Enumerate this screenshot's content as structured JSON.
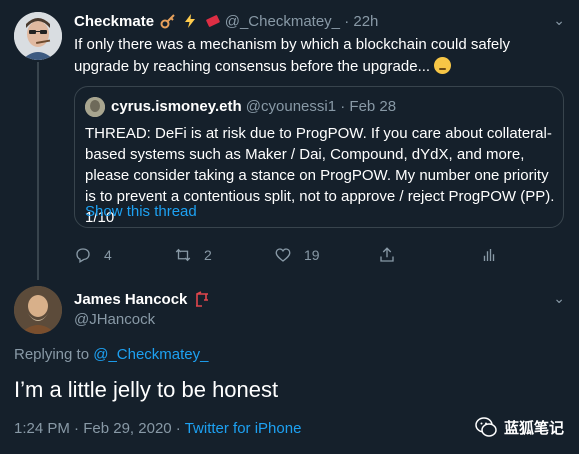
{
  "tweet": {
    "name": "Checkmate",
    "handle": "@_Checkmatey_",
    "separator": "·",
    "time": "22h",
    "text": "If only there was a mechanism by which a blockchain could safely upgrade by reaching consensus before the upgrade..."
  },
  "quote": {
    "name": "cyrus.ismoney.eth",
    "handle": "@cyounessi1",
    "separator": "·",
    "date": "Feb 28",
    "text": "THREAD: DeFi is at risk due to ProgPOW. If you care about collateral-based systems such as Maker / Dai, Compound, dYdX, and more, please consider taking a stance on ProgPOW. My number one priority is to prevent a contentious split, not to approve / reject ProgPOW (PP). 1/10",
    "show_thread": "Show this thread"
  },
  "actions": {
    "reply_count": "4",
    "retweet_count": "2",
    "like_count": "19"
  },
  "reply": {
    "name": "James Hancock",
    "handle": "@JHancock",
    "replying_label": "Replying to",
    "replying_to": "@_Checkmatey_",
    "text": "I’m a little jelly to be honest",
    "time": "1:24 PM",
    "sep1": "·",
    "date": "Feb 29, 2020",
    "sep2": "·",
    "source": "Twitter for iPhone"
  },
  "watermark": {
    "text": "蓝狐笔记"
  },
  "colors": {
    "background": "#15202b",
    "muted": "#8899a6",
    "link": "#1da1f2",
    "border": "#38444d"
  }
}
